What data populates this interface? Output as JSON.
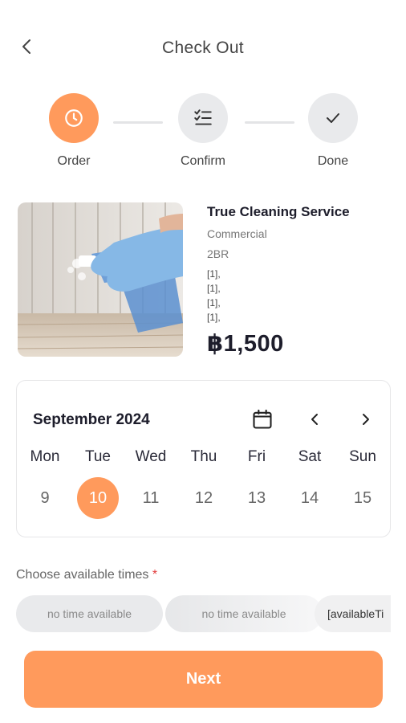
{
  "header": {
    "title": "Check Out",
    "back_icon": "chevron-left-icon"
  },
  "stepper": {
    "steps": [
      {
        "label": "Order",
        "icon": "clock-icon",
        "active": true
      },
      {
        "label": "Confirm",
        "icon": "checklist-icon",
        "active": false
      },
      {
        "label": "Done",
        "icon": "check-icon",
        "active": false
      }
    ]
  },
  "service": {
    "name": "True Cleaning Service",
    "type": "Commercial",
    "size": "2BR",
    "options": [
      "[1],",
      "[1],",
      "[1],",
      "[1],"
    ],
    "price": "฿1,500"
  },
  "calendar": {
    "month": "September 2024",
    "days": [
      "Mon",
      "Tue",
      "Wed",
      "Thu",
      "Fri",
      "Sat",
      "Sun"
    ],
    "dates": [
      "9",
      "10",
      "11",
      "12",
      "13",
      "14",
      "15"
    ],
    "selected": "10"
  },
  "times": {
    "label": "Choose available times",
    "required_mark": "*",
    "chips": [
      "no time available",
      "no time available",
      "[availableTi"
    ]
  },
  "next_button": "Next",
  "colors": {
    "accent": "#ff9a5c",
    "inactive": "#e9eaec",
    "text_dark": "#1d1d2b"
  }
}
